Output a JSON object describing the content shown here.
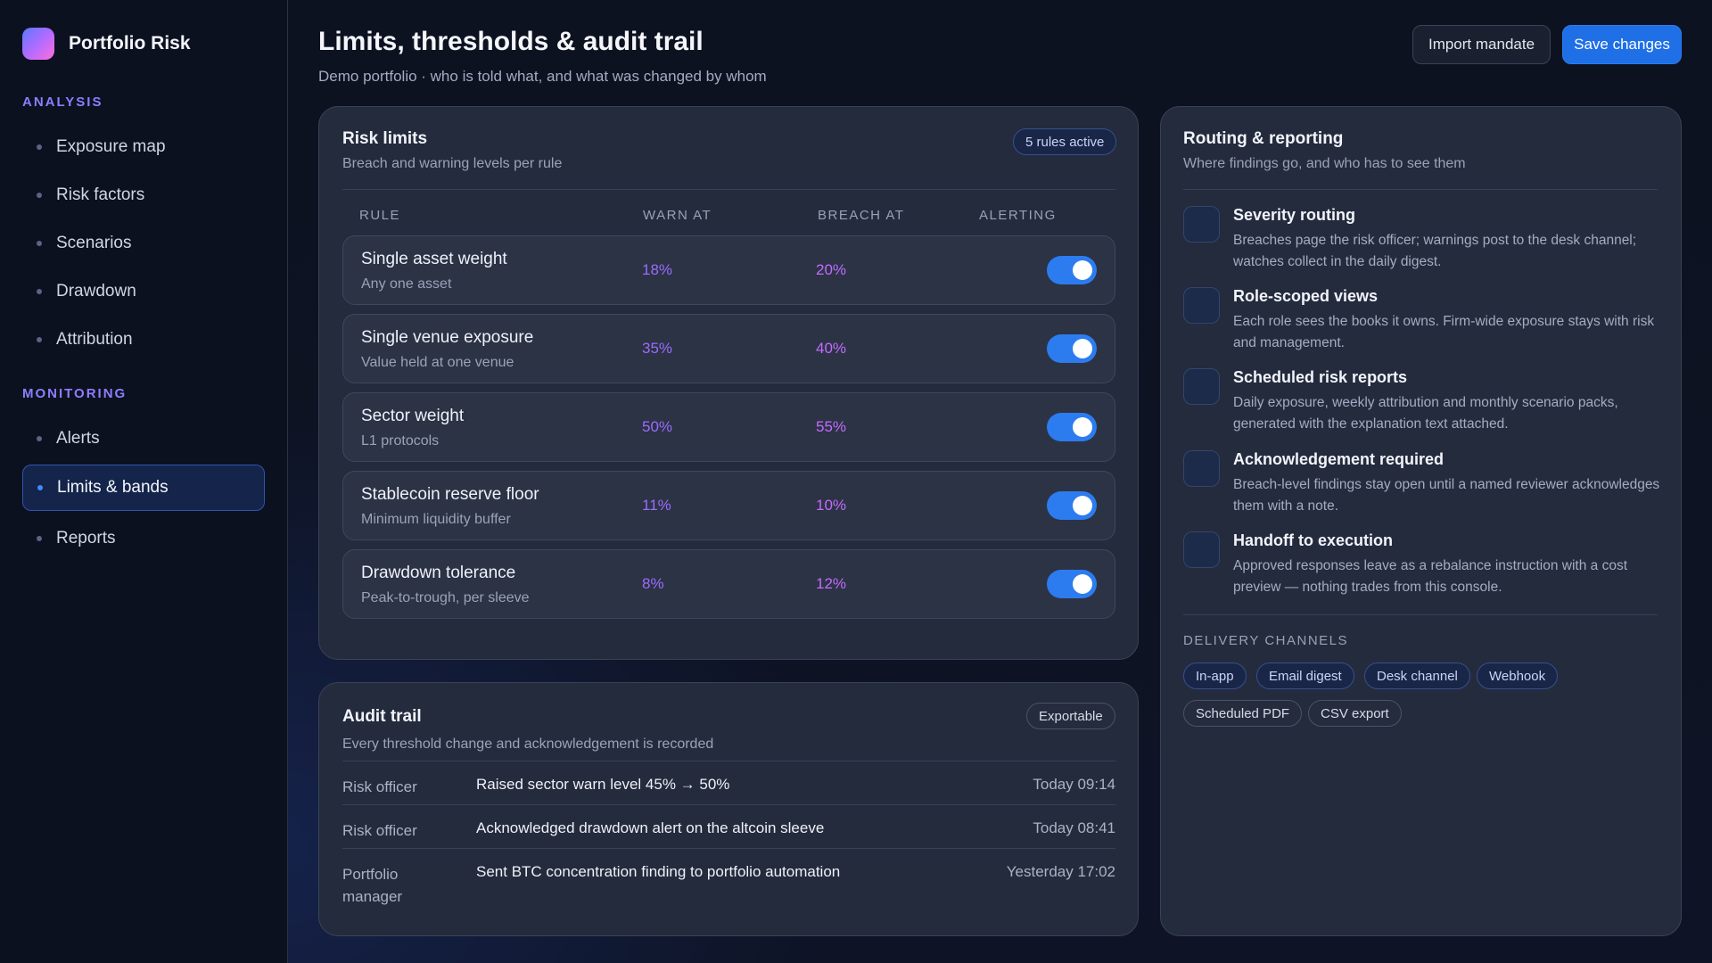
{
  "sidebar": {
    "brand": "Portfolio Risk",
    "sections": [
      {
        "label": "ANALYSIS",
        "items": [
          "Exposure map",
          "Risk factors",
          "Scenarios",
          "Drawdown",
          "Attribution"
        ]
      },
      {
        "label": "MONITORING",
        "items": [
          "Alerts",
          "Limits & bands",
          "Reports"
        ]
      }
    ],
    "active_item": "Limits & bands"
  },
  "header": {
    "title": "Limits, thresholds & audit trail",
    "subtitle": "Demo portfolio · who is told what, and what was changed by whom",
    "import_button": "Import mandate",
    "save_button": "Save changes"
  },
  "risk_limits": {
    "title": "Risk limits",
    "subtitle": "Breach and warning levels per rule",
    "badge": "5 rules active",
    "columns": [
      "RULE",
      "WARN AT",
      "BREACH AT",
      "ALERTING"
    ],
    "rules": [
      {
        "name": "Single asset weight",
        "desc": "Any one asset",
        "warn": "18%",
        "breach": "20%",
        "alerting": true
      },
      {
        "name": "Single venue exposure",
        "desc": "Value held at one venue",
        "warn": "35%",
        "breach": "40%",
        "alerting": true
      },
      {
        "name": "Sector weight",
        "desc": "L1 protocols",
        "warn": "50%",
        "breach": "55%",
        "alerting": true
      },
      {
        "name": "Stablecoin reserve floor",
        "desc": "Minimum liquidity buffer",
        "warn": "11%",
        "breach": "10%",
        "alerting": true
      },
      {
        "name": "Drawdown tolerance",
        "desc": "Peak-to-trough, per sleeve",
        "warn": "8%",
        "breach": "12%",
        "alerting": true
      }
    ]
  },
  "audit": {
    "title": "Audit trail",
    "subtitle": "Every threshold change and acknowledgement is recorded",
    "badge": "Exportable",
    "entries": [
      {
        "who": "Risk officer",
        "what": "Raised sector warn level 45% → 50%",
        "when": "Today 09:14"
      },
      {
        "who": "Risk officer",
        "what": "Acknowledged drawdown alert on the altcoin sleeve",
        "when": "Today 08:41"
      },
      {
        "who": "Portfolio manager",
        "what": "Sent BTC concentration finding to portfolio automation",
        "when": "Yesterday 17:02"
      }
    ]
  },
  "routing": {
    "title": "Routing & reporting",
    "subtitle": "Where findings go, and who has to see them",
    "items": [
      {
        "title": "Severity routing",
        "desc": "Breaches page the risk officer; warnings post to the desk channel; watches collect in the daily digest."
      },
      {
        "title": "Role-scoped views",
        "desc": "Each role sees the books it owns. Firm-wide exposure stays with risk and management."
      },
      {
        "title": "Scheduled risk reports",
        "desc": "Daily exposure, weekly attribution and monthly scenario packs, generated with the explanation text attached."
      },
      {
        "title": "Acknowledgement required",
        "desc": "Breach-level findings stay open until a named reviewer acknowledges them with a note."
      },
      {
        "title": "Handoff to execution",
        "desc": "Approved responses leave as a rebalance instruction with a cost preview — nothing trades from this console."
      }
    ],
    "channels_label": "DELIVERY CHANNELS",
    "channels": [
      "In-app",
      "Email digest",
      "Desk channel",
      "Webhook",
      "Scheduled PDF",
      "CSV export"
    ]
  },
  "colors": {
    "accent": "#1f6fe6",
    "warn": "#9d6bff",
    "breach": "#c46bff",
    "section_label": "#8f7dff"
  }
}
